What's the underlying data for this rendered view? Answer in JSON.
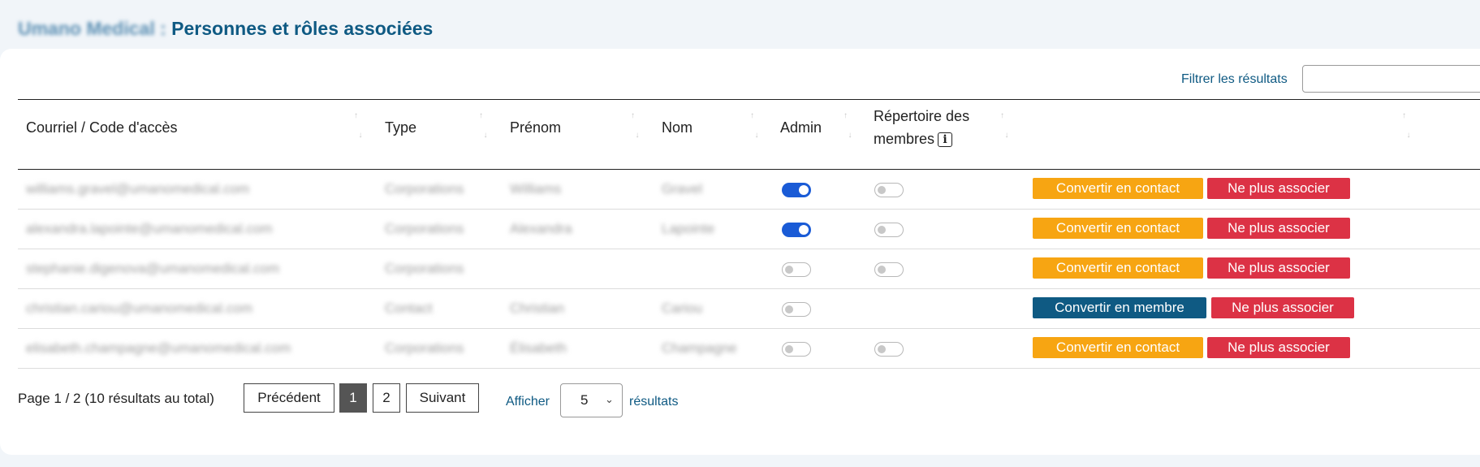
{
  "header": {
    "org_name": "Umano Medical",
    "separator": " : ",
    "title": "Personnes et rôles associées"
  },
  "filter": {
    "label": "Filtrer les résultats",
    "value": ""
  },
  "columns": {
    "email": "Courriel / Code d'accès",
    "type": "Type",
    "first_name": "Prénom",
    "last_name": "Nom",
    "admin": "Admin",
    "directory_line1": "Répertoire des",
    "directory_line2": "membres",
    "info_icon": "i"
  },
  "rows": [
    {
      "email": "williams.gravel@umanomedical.com",
      "type": "Corporations",
      "first_name": "Williams",
      "last_name": "Gravel",
      "admin": true,
      "directory": false,
      "convert_label": "Convertir en contact",
      "remove_label": "Ne plus associer"
    },
    {
      "email": "alexandra.lapointe@umanomedical.com",
      "type": "Corporations",
      "first_name": "Alexandra",
      "last_name": "Lapointe",
      "admin": true,
      "directory": false,
      "convert_label": "Convertir en contact",
      "remove_label": "Ne plus associer"
    },
    {
      "email": "stephanie.digenova@umanomedical.com",
      "type": "Corporations",
      "first_name": "",
      "last_name": "",
      "admin": false,
      "directory": false,
      "convert_label": "Convertir en contact",
      "remove_label": "Ne plus associer"
    },
    {
      "email": "christian.cariou@umanomedical.com",
      "type": "Contact",
      "first_name": "Christian",
      "last_name": "Cariou",
      "admin": false,
      "directory": null,
      "convert_label": "Convertir en membre",
      "remove_label": "Ne plus associer"
    },
    {
      "email": "elisabeth.champagne@umanomedical.com",
      "type": "Corporations",
      "first_name": "Élisabeth",
      "last_name": "Champagne",
      "admin": false,
      "directory": false,
      "convert_label": "Convertir en contact",
      "remove_label": "Ne plus associer"
    }
  ],
  "pagination": {
    "info": "Page 1 / 2 (10 résultats au total)",
    "previous": "Précédent",
    "pages": [
      "1",
      "2"
    ],
    "current_page": "1",
    "next": "Suivant",
    "show_label": "Afficher",
    "page_size": "5",
    "results_label": "résultats"
  },
  "colors": {
    "title": "#0f5a83",
    "toggle_on": "#1a5bd6",
    "convert_contact": "#f7a512",
    "convert_member": "#0f5a83",
    "remove": "#dc3245"
  }
}
